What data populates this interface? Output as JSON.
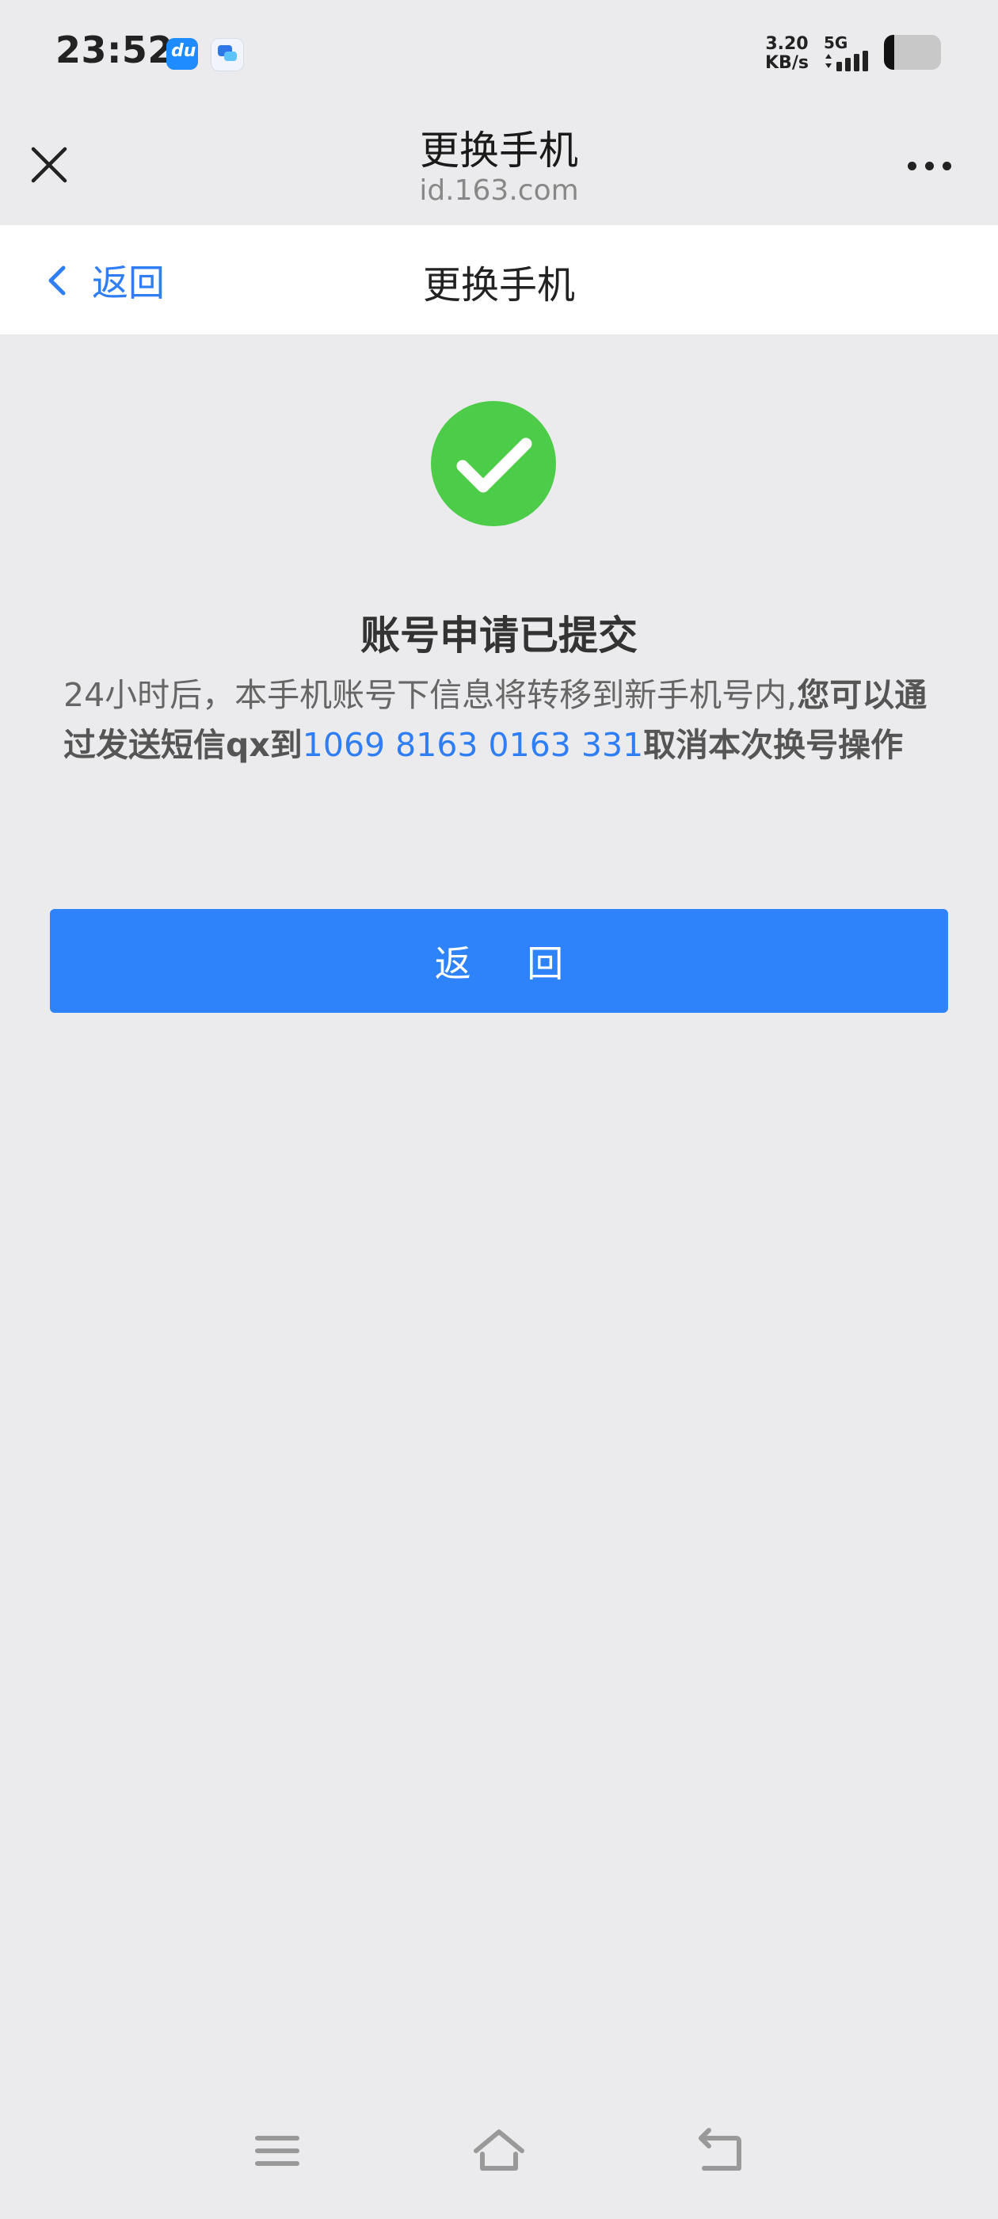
{
  "status_bar": {
    "time": "23:52",
    "net_speed_value": "3.20",
    "net_speed_unit": "KB/s",
    "network_type": "5G",
    "battery_level": 0.18,
    "app_icon_text": "du"
  },
  "title_bar": {
    "title": "更换手机",
    "subtitle": "id.163.com"
  },
  "page_header": {
    "back_label": "返回",
    "title": "更换手机"
  },
  "result": {
    "title": "账号申请已提交",
    "message_part1": "24小时后，本手机账号下信息将转移到新手机号内,",
    "message_part2": "您可以通过发送短信qx到",
    "sms_number": "1069 8163 0163 331",
    "message_part3": "取消本次换号操作"
  },
  "primary_button": {
    "label": "返 回"
  },
  "colors": {
    "accent_blue": "#2f83fa",
    "success_green": "#4ccc49",
    "background": "#ebebed"
  },
  "icons": {
    "close": "close-icon",
    "more": "more-icon",
    "back": "chevron-left-icon",
    "success": "check-icon",
    "menu": "menu-icon",
    "home": "home-icon",
    "back_nav": "back-arrow-icon"
  }
}
